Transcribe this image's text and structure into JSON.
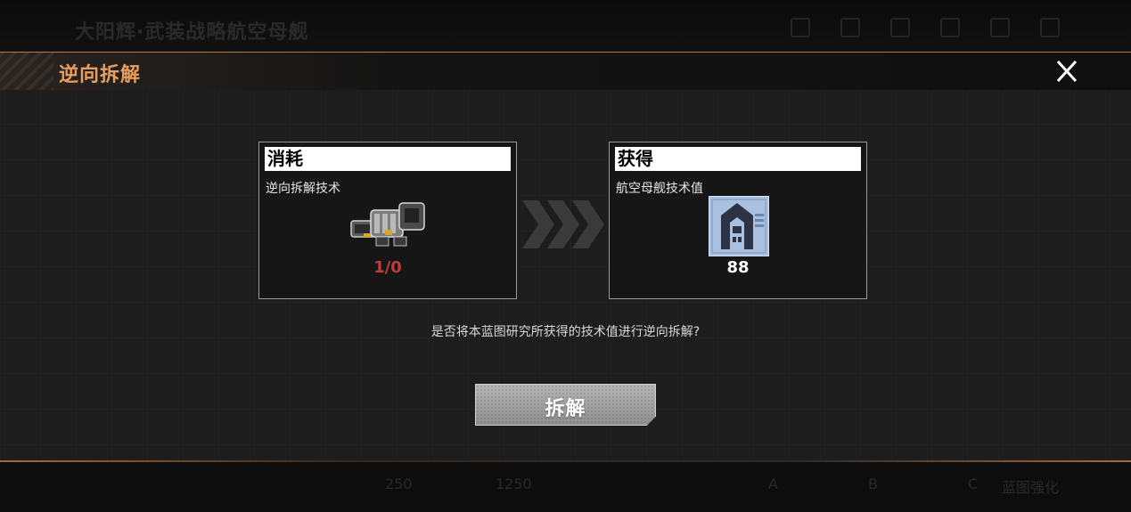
{
  "background": {
    "title": "大阳辉·武装战略航空母舰",
    "bottom_values": [
      "250",
      "1250"
    ],
    "bottom_tabs": [
      "A",
      "B",
      "C"
    ],
    "bottom_label": "蓝图强化"
  },
  "dialog": {
    "title": "逆向拆解",
    "close_icon": "close-icon",
    "consume": {
      "label": "消耗",
      "item_name": "逆向拆解技术",
      "count": "1/0",
      "icon": "mechanical-part-icon"
    },
    "gain": {
      "label": "获得",
      "item_name": "航空母舰技术值",
      "count": "88",
      "icon": "carrier-tech-icon"
    },
    "prompt": "是否将本蓝图研究所获得的技术值进行逆向拆解?",
    "confirm_label": "拆解"
  },
  "colors": {
    "title_accent": "#e89e5c",
    "insufficient": "#c23b3b",
    "divider": "#b77a44"
  }
}
